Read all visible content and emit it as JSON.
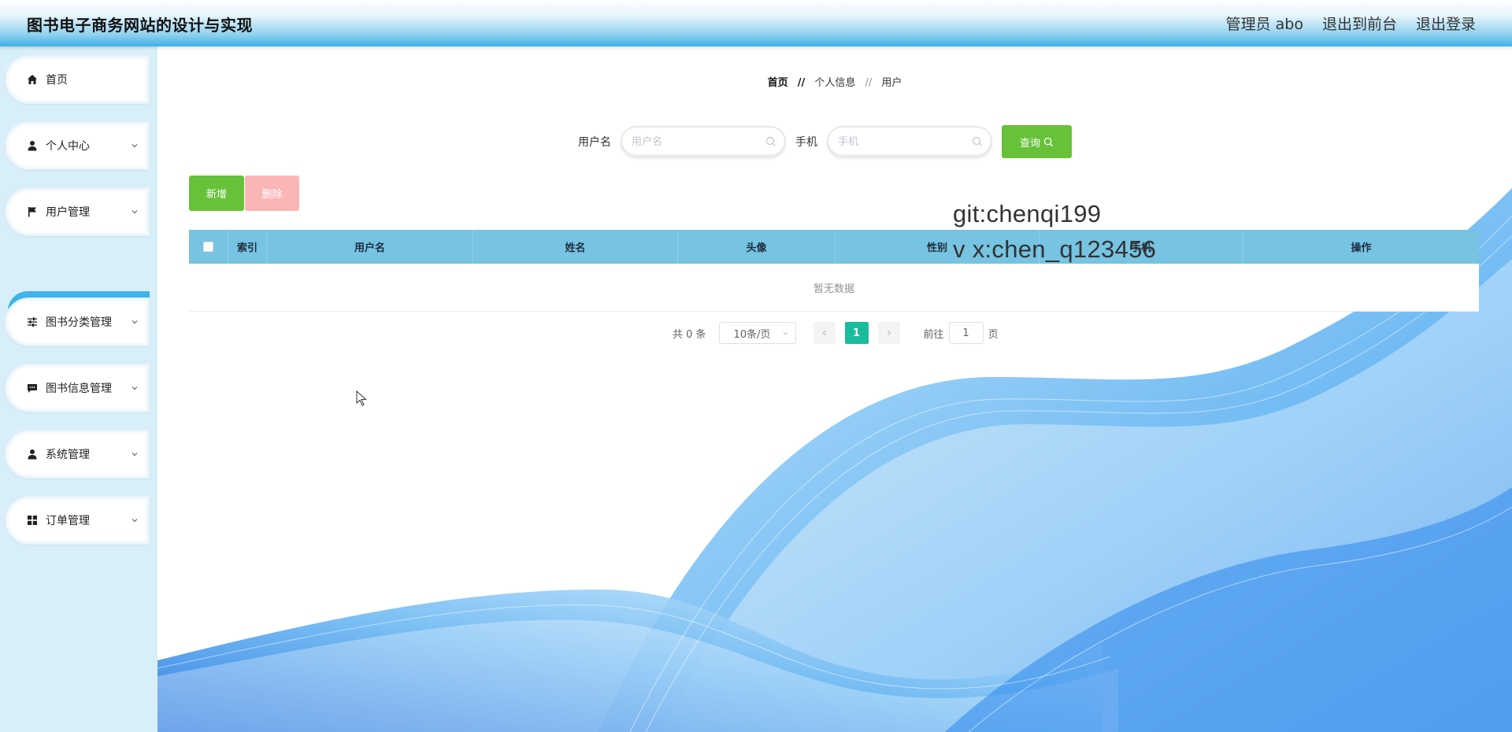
{
  "header": {
    "title": "图书电子商务网站的设计与实现",
    "admin": "管理员 abo",
    "to_front": "退出到前台",
    "logout": "退出登录"
  },
  "sidebar": {
    "items": [
      {
        "label": "首页",
        "icon": "home-icon"
      },
      {
        "label": "个人中心",
        "icon": "user-icon"
      },
      {
        "label": "用户管理",
        "icon": "flag-icon"
      },
      {
        "label": "图书分类管理",
        "icon": "sliders-icon"
      },
      {
        "label": "图书信息管理",
        "icon": "chat-icon"
      },
      {
        "label": "系统管理",
        "icon": "user-icon"
      },
      {
        "label": "订单管理",
        "icon": "grid-icon"
      }
    ],
    "active_sub": "用户"
  },
  "breadcrumb": {
    "home": "首页",
    "sep": "//",
    "level1": "个人信息",
    "level2": "用户"
  },
  "search": {
    "username_label": "用户名",
    "username_placeholder": "用户名",
    "username_value": "",
    "phone_label": "手机",
    "phone_placeholder": "手机",
    "phone_value": "",
    "query_label": "查询"
  },
  "actions": {
    "add": "新增",
    "delete": "删除"
  },
  "table": {
    "columns": [
      "索引",
      "用户名",
      "姓名",
      "头像",
      "性别",
      "手机",
      "操作"
    ],
    "empty_text": "暂无数据"
  },
  "pagination": {
    "total": "共 0 条",
    "page_size": "10条/页",
    "current_page": "1",
    "goto_label": "前往",
    "goto_value": "1",
    "page_suffix": "页"
  },
  "watermark": {
    "line1": "git:chenqi199",
    "line2": "v x:chen_q123456"
  },
  "colors": {
    "accent": "#3fb4ea",
    "table_header": "#76c3e2",
    "success": "#67c23a",
    "danger_light": "#fab6b6",
    "pager_active": "#1abc9c"
  }
}
